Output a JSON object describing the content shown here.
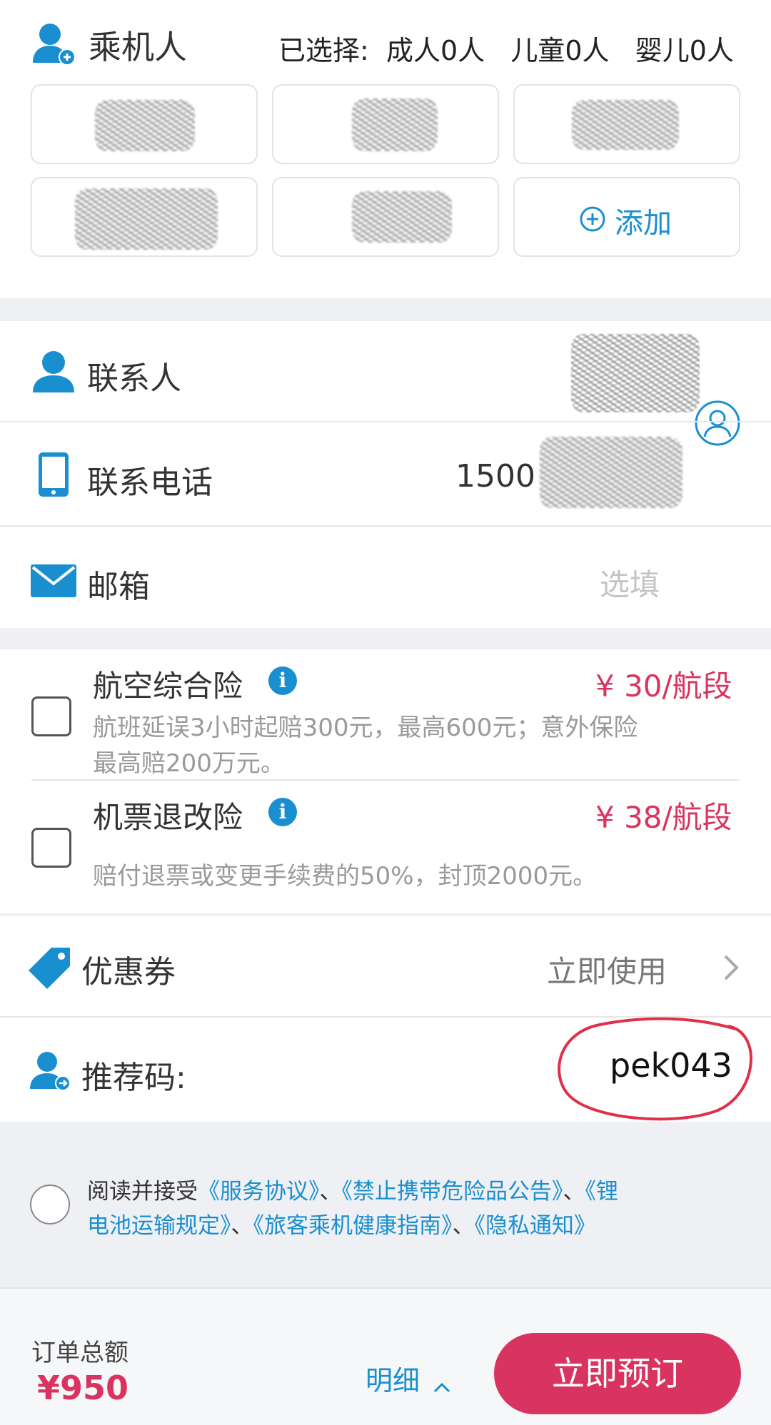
{
  "passengers": {
    "title": "乘机人",
    "selected_summary": "已选择:  成人0人   儿童0人   婴儿0人",
    "add_label": "添加"
  },
  "contact": {
    "name_label": "联系人",
    "phone_label": "联系电话",
    "phone_value": "1500",
    "email_label": "邮箱",
    "email_placeholder": "选填"
  },
  "insurance": [
    {
      "title": "航空综合险",
      "price": "¥ 30/航段",
      "desc_line1": "航班延误3小时起赔300元，最高600元；意外保险",
      "desc_line2": "最高赔200万元。"
    },
    {
      "title": "机票退改险",
      "price": "¥ 38/航段",
      "desc_line1": "赔付退票或变更手续费的50%，封顶2000元。"
    }
  ],
  "coupon": {
    "label": "优惠券",
    "action": "立即使用"
  },
  "referral": {
    "label": "推荐码:",
    "value": "pek043"
  },
  "agreement": {
    "prefix": "阅读并接受",
    "link1": "《服务协议》",
    "sep": "、",
    "link2": "《禁止携带危险品公告》",
    "link3a": "《锂",
    "link3b": "电池运输规定》",
    "link4": "《旅客乘机健康指南》",
    "link5": "《隐私通知》"
  },
  "footer": {
    "total_label": "订单总额",
    "total_value": "¥950",
    "details_label": "明细",
    "book_button": "立即预订"
  },
  "colors": {
    "accent_blue": "#1a8fd0",
    "price_red": "#d8345f",
    "annotation_red": "#e03048"
  }
}
